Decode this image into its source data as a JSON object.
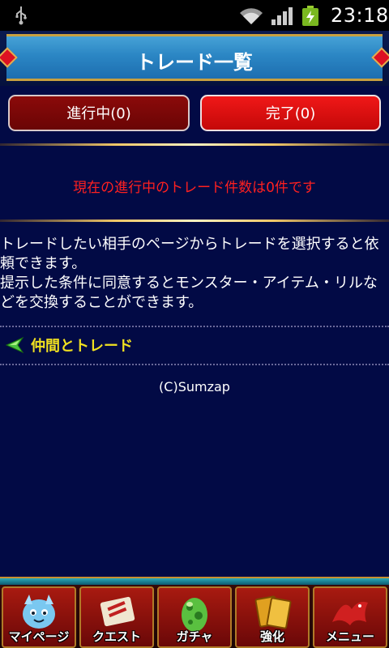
{
  "status_bar": {
    "time": "23:18"
  },
  "header": {
    "title": "トレード一覧"
  },
  "tabs": [
    {
      "label": "進行中(0)"
    },
    {
      "label": "完了(0)"
    }
  ],
  "notice": "現在の進行中のトレード件数は0件です",
  "description": [
    "トレードしたい相手のページからトレードを選択すると依頼できます。",
    "提示した条件に同意するとモンスター・アイテム・リルなどを交換することができます。"
  ],
  "friend_trade_link": "仲間とトレード",
  "copyright": "(C)Sumzap",
  "bottom_nav": [
    {
      "label": "マイページ",
      "icon": "mypage-icon"
    },
    {
      "label": "クエスト",
      "icon": "quest-icon"
    },
    {
      "label": "ガチャ",
      "icon": "gacha-egg-icon"
    },
    {
      "label": "強化",
      "icon": "power-up-cards-icon"
    },
    {
      "label": "メニュー",
      "icon": "menu-dragon-icon"
    }
  ],
  "colors": {
    "background": "#020a45",
    "header_blue": "#2b86c4",
    "notice_red": "#ff2020",
    "link_yellow": "#f0e020",
    "tab_active": "#c40808",
    "tab_inactive": "#6a0505"
  }
}
